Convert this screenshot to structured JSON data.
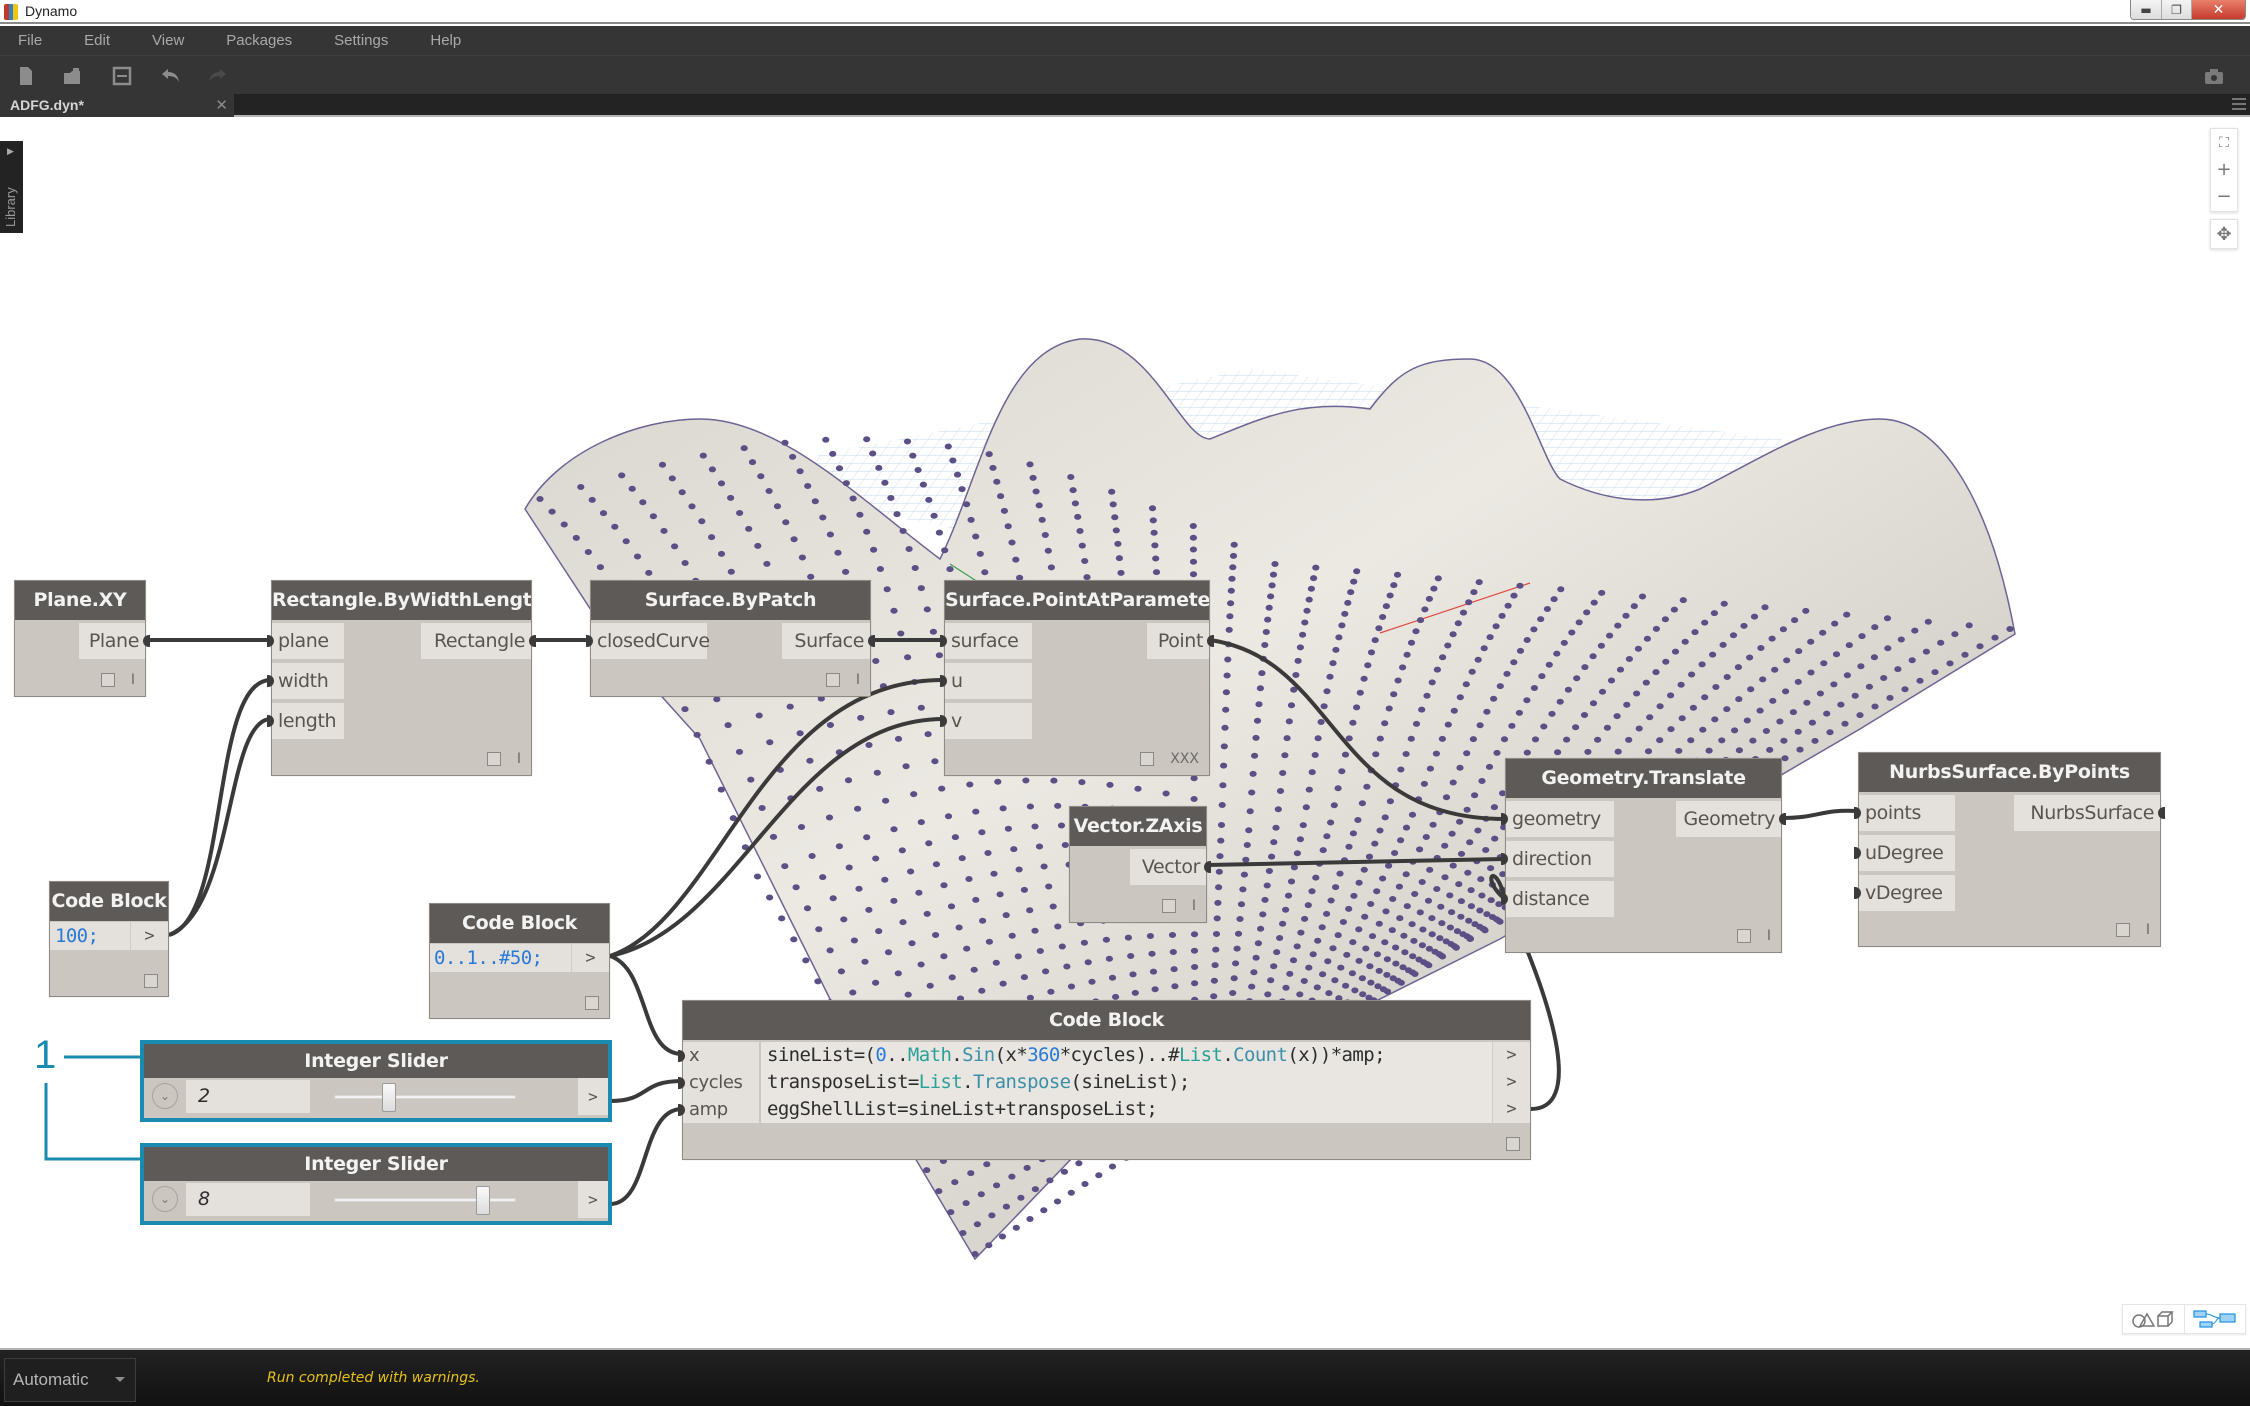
{
  "window": {
    "title": "Dynamo",
    "controls": [
      "minimize",
      "restore",
      "close"
    ]
  },
  "menu": [
    "File",
    "Edit",
    "View",
    "Packages",
    "Settings",
    "Help"
  ],
  "toolbar": {
    "buttons": [
      "new-file",
      "open-file",
      "save-file",
      "undo",
      "redo"
    ],
    "right": "screenshot-camera"
  },
  "tabs": [
    {
      "label": "ADFG.dyn*",
      "active": true
    }
  ],
  "library_label": "Library",
  "nodes": {
    "plane_xy": {
      "title": "Plane.XY",
      "outputs": [
        "Plane"
      ],
      "lacing": "I"
    },
    "rect": {
      "title": "Rectangle.ByWidthLength",
      "inputs": [
        "plane",
        "width",
        "length"
      ],
      "outputs": [
        "Rectangle"
      ],
      "lacing": "I"
    },
    "surf_patch": {
      "title": "Surface.ByPatch",
      "inputs": [
        "closedCurve"
      ],
      "outputs": [
        "Surface"
      ],
      "lacing": "I"
    },
    "surf_pap": {
      "title": "Surface.PointAtParameter",
      "inputs": [
        "surface",
        "u",
        "v"
      ],
      "outputs": [
        "Point"
      ],
      "lacing": "XXX"
    },
    "geo_translate": {
      "title": "Geometry.Translate",
      "inputs": [
        "geometry",
        "direction",
        "distance"
      ],
      "outputs": [
        "Geometry"
      ],
      "lacing": "I"
    },
    "nurbs": {
      "title": "NurbsSurface.ByPoints",
      "inputs": [
        "points",
        "uDegree",
        "vDegree"
      ],
      "outputs": [
        "NurbsSurface"
      ],
      "lacing": "I"
    },
    "vector_z": {
      "title": "Vector.ZAxis",
      "outputs": [
        "Vector"
      ],
      "lacing": "I"
    },
    "cb_100": {
      "title": "Code Block",
      "code": "100;",
      "out": ">"
    },
    "cb_range": {
      "title": "Code Block",
      "code": "0..1..#50;",
      "out": ">"
    },
    "cb_main": {
      "title": "Code Block",
      "inputs": [
        "x",
        "cycles",
        "amp"
      ],
      "lines": [
        "sineList=(0..Math.Sin(x*360*cycles)..#List.Count(x))*amp;",
        "transposeList=List.Transpose(sineList);",
        "eggShellList=sineList+transposeList;"
      ],
      "outs": [
        ">",
        ">",
        ">"
      ]
    },
    "slider1": {
      "title": "Integer Slider",
      "value": "2",
      "fraction": 0.3,
      "out": ">"
    },
    "slider2": {
      "title": "Integer Slider",
      "value": "8",
      "fraction": 0.82,
      "out": ">"
    }
  },
  "callout": {
    "label": "1"
  },
  "statusbar": {
    "run_mode": "Automatic",
    "message": "Run completed with warnings."
  },
  "colors": {
    "accent_callout": "#1a8bb0",
    "node_header": "#5e5a57",
    "node_body": "#cbc6bf",
    "point_color": "#5c4f86",
    "status_warning": "#e8c21a"
  }
}
